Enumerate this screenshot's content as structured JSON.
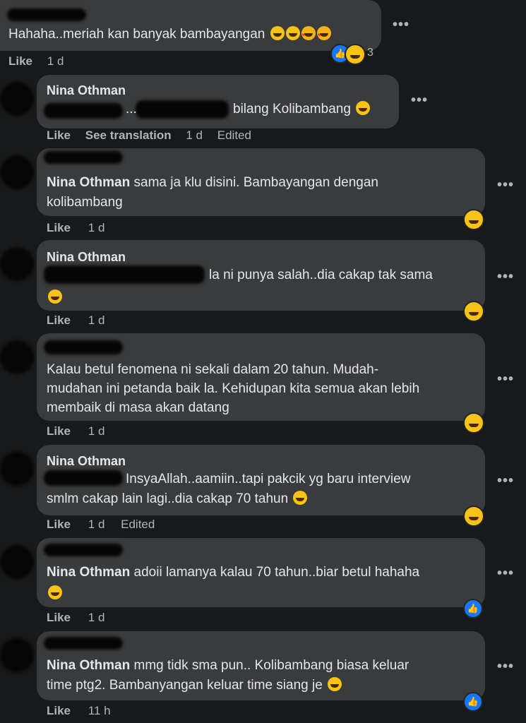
{
  "comments": [
    {
      "text": "Hahaha..meriah kan banyak bambayangan",
      "actions": {
        "like": "Like",
        "time": "1 d"
      },
      "reactions": {
        "count": "3"
      }
    },
    {
      "author": "Nina Othman",
      "text_fragments": [
        "...",
        "bilang Kolibambang"
      ],
      "actions": {
        "like": "Like",
        "translate": "See translation",
        "time": "1 d",
        "edited": "Edited"
      }
    },
    {
      "author": "Nina Othman",
      "lines": [
        "sama ja klu disini. Bambayangan dengan",
        "kolibambang"
      ],
      "actions": {
        "like": "Like",
        "time": "1 d"
      }
    },
    {
      "author": "Nina Othman",
      "text": "la ni punya salah..dia cakap tak sama",
      "actions": {
        "like": "Like",
        "time": "1 d"
      }
    },
    {
      "lines": [
        "Kalau betul fenomena ni sekali dalam 20 tahun. Mudah-",
        "mudahan ini petanda baik la. Kehidupan kita semua akan lebih",
        "membaik di masa akan datang"
      ],
      "actions": {
        "like": "Like",
        "time": "1 d"
      }
    },
    {
      "author": "Nina Othman",
      "lines": [
        "InsyaAllah..aamiin..tapi pakcik yg baru interview",
        "smlm cakap lain lagi..dia cakap 70 tahun"
      ],
      "actions": {
        "like": "Like",
        "time": "1 d",
        "edited": "Edited"
      }
    },
    {
      "author": "Nina Othman",
      "text": "adoii lamanya kalau 70 tahun..biar betul hahaha",
      "actions": {
        "like": "Like",
        "time": "1 d"
      }
    },
    {
      "author": "Nina Othman",
      "lines": [
        "mmg tidk sma pun.. Kolibambang biasa keluar",
        "time ptg2. Bambanyangan keluar time siang je"
      ],
      "actions": {
        "like": "Like",
        "time": "11 h"
      }
    }
  ],
  "icons": {
    "more": "more-options-icon",
    "emoji": "emoji-icon",
    "like_reaction": "like-reaction-icon",
    "haha_reaction": "haha-reaction-icon"
  },
  "colors": {
    "background": "#18191a",
    "bubble": "#3a3b3c",
    "text": "#e4e6eb",
    "meta": "#b0b3b8",
    "like_blue": "#1877f2"
  }
}
